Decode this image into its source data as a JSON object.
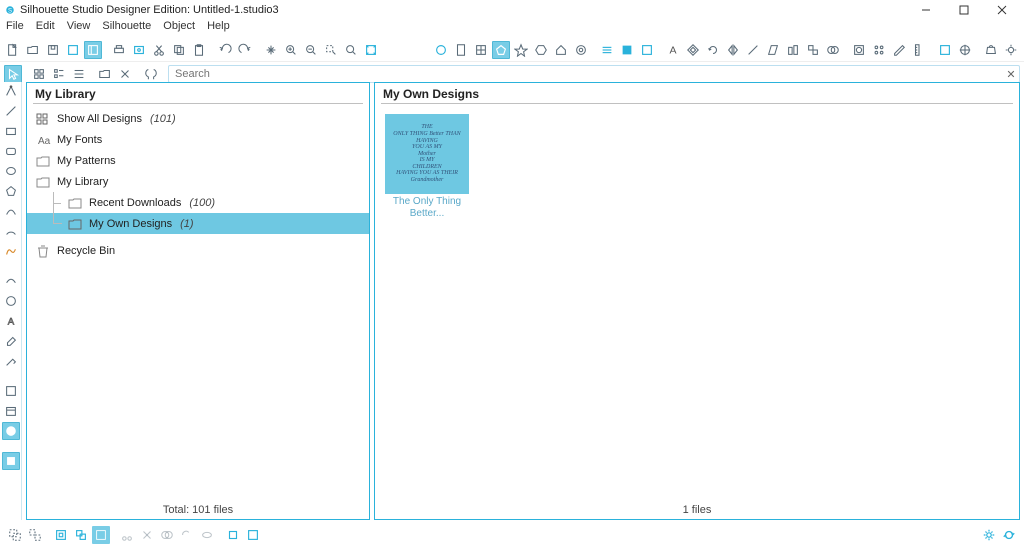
{
  "app": {
    "title": "Silhouette Studio Designer Edition: Untitled-1.studio3"
  },
  "menu": {
    "file": "File",
    "edit": "Edit",
    "view": "View",
    "silhouette": "Silhouette",
    "object": "Object",
    "help": "Help"
  },
  "search": {
    "placeholder": "Search"
  },
  "library": {
    "header": "My Library",
    "footer": "Total: 101 files",
    "items": {
      "show_all": {
        "label": "Show All Designs",
        "count": "(101)"
      },
      "my_fonts": {
        "label": "My Fonts"
      },
      "my_patterns": {
        "label": "My Patterns"
      },
      "my_library": {
        "label": "My Library"
      },
      "recent": {
        "label": "Recent Downloads",
        "count": "(100)"
      },
      "my_own": {
        "label": "My Own Designs",
        "count": "(1)"
      },
      "recycle": {
        "label": "Recycle Bin"
      }
    }
  },
  "designs": {
    "header": "My Own Designs",
    "footer": "1 files",
    "thumb": {
      "label": "The Only Thing Better...",
      "art_lines": "THE\nONLY THING Better THAN HAVING\nYOU AS MY\nMother\nIS MY\nCHILDREN\nHAVING YOU AS THEIR\nGrandmother"
    }
  }
}
